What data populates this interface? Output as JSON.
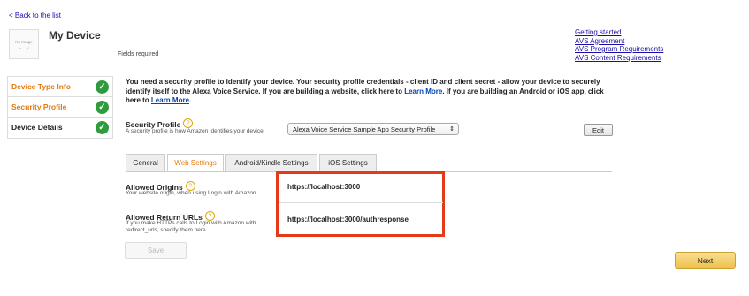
{
  "header": {
    "back_link": "< Back to the list",
    "no_image": "No Image",
    "device_name": "My Device",
    "fields_required": "Fields required"
  },
  "top_links": [
    "Getting started",
    "AVS Agreement",
    "AVS Program Requirements",
    "AVS Content Requirements"
  ],
  "steps": [
    {
      "label": "Device Type Info",
      "color": "#e47911",
      "completed": true
    },
    {
      "label": "Security Profile",
      "color": "#e47911",
      "completed": true
    },
    {
      "label": "Device Details",
      "color": "#222222",
      "completed": true
    }
  ],
  "intro": {
    "text1": "You need a security profile to identify your device. Your security profile credentials - client ID and client secret - allow your device to securely identify itself to the Alexa Voice Service. If you are building a website, click here to ",
    "link1": "Learn More",
    "text2": ". If you are building an Android or iOS app, click here to ",
    "link2": "Learn More",
    "text3": "."
  },
  "security_profile": {
    "label": "Security Profile",
    "help": "?",
    "description": "A security profile is how Amazon identifies your device.",
    "selected": "Alexa Voice Service Sample App Security Profile",
    "edit_label": "Edit"
  },
  "tabs": [
    {
      "label": "General",
      "active": false
    },
    {
      "label": "Web Settings",
      "active": true
    },
    {
      "label": "Android/Kindle Settings",
      "active": false
    },
    {
      "label": "iOS Settings",
      "active": false
    }
  ],
  "allowed_origins": {
    "label": "Allowed Origins",
    "help": "?",
    "description": "Your website origin, when using Login with Amazon",
    "value": "https://localhost:3000"
  },
  "allowed_return_urls": {
    "label": "Allowed Return URLs",
    "help": "?",
    "description": "If you make HTTPs calls to Login with Amazon with redirect_urls, specify them here.",
    "value": "https://localhost:3000/authresponse"
  },
  "buttons": {
    "save": "Save",
    "next": "Next"
  },
  "colors": {
    "accent": "#e47911",
    "check": "#2e9b3c",
    "highlight": "#e53a18",
    "next": "#f0c14b"
  }
}
